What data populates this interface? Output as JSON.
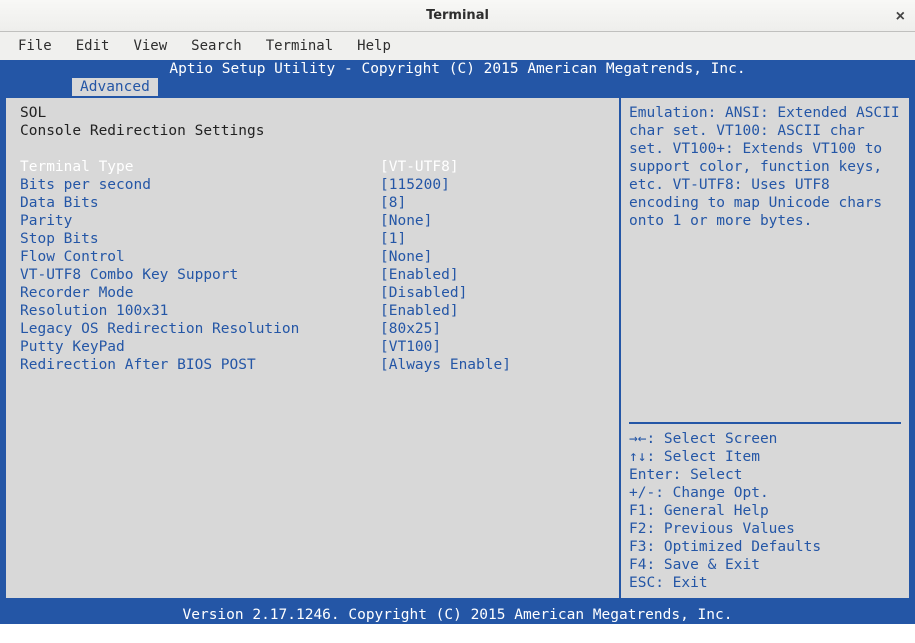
{
  "window": {
    "title": "Terminal",
    "close": "×"
  },
  "menubar": {
    "file": "File",
    "edit": "Edit",
    "view": "View",
    "search": "Search",
    "terminal": "Terminal",
    "help": "Help"
  },
  "bios": {
    "header": "Aptio Setup Utility - Copyright (C) 2015 American Megatrends, Inc.",
    "tab": "Advanced",
    "footer": "Version 2.17.1246. Copyright (C) 2015 American Megatrends, Inc.",
    "section1": "SOL",
    "section2": "Console Redirection Settings",
    "settings": [
      {
        "label": "Terminal Type",
        "value": "[VT-UTF8]",
        "selected": true
      },
      {
        "label": "Bits per second",
        "value": "[115200]",
        "selected": false
      },
      {
        "label": "Data Bits",
        "value": "[8]",
        "selected": false
      },
      {
        "label": "Parity",
        "value": "[None]",
        "selected": false
      },
      {
        "label": "Stop Bits",
        "value": "[1]",
        "selected": false
      },
      {
        "label": "Flow Control",
        "value": "[None]",
        "selected": false
      },
      {
        "label": "VT-UTF8 Combo Key Support",
        "value": "[Enabled]",
        "selected": false
      },
      {
        "label": "Recorder Mode",
        "value": "[Disabled]",
        "selected": false
      },
      {
        "label": "Resolution 100x31",
        "value": "[Enabled]",
        "selected": false
      },
      {
        "label": "Legacy OS Redirection Resolution",
        "value": "[80x25]",
        "selected": false
      },
      {
        "label": "Putty KeyPad",
        "value": "[VT100]",
        "selected": false
      },
      {
        "label": "Redirection After BIOS POST",
        "value": "[Always Enable]",
        "selected": false
      }
    ],
    "help": "Emulation: ANSI: Extended ASCII char set. VT100: ASCII char set. VT100+: Extends VT100 to support color, function keys, etc. VT-UTF8: Uses UTF8 encoding to map Unicode chars onto 1 or more bytes.",
    "nav": {
      "l1": "→←: Select Screen",
      "l2": "↑↓: Select Item",
      "l3": "Enter: Select",
      "l4": "+/-: Change Opt.",
      "l5": "F1: General Help",
      "l6": "F2: Previous Values",
      "l7": "F3: Optimized Defaults",
      "l8": "F4: Save & Exit",
      "l9": "ESC: Exit"
    }
  }
}
